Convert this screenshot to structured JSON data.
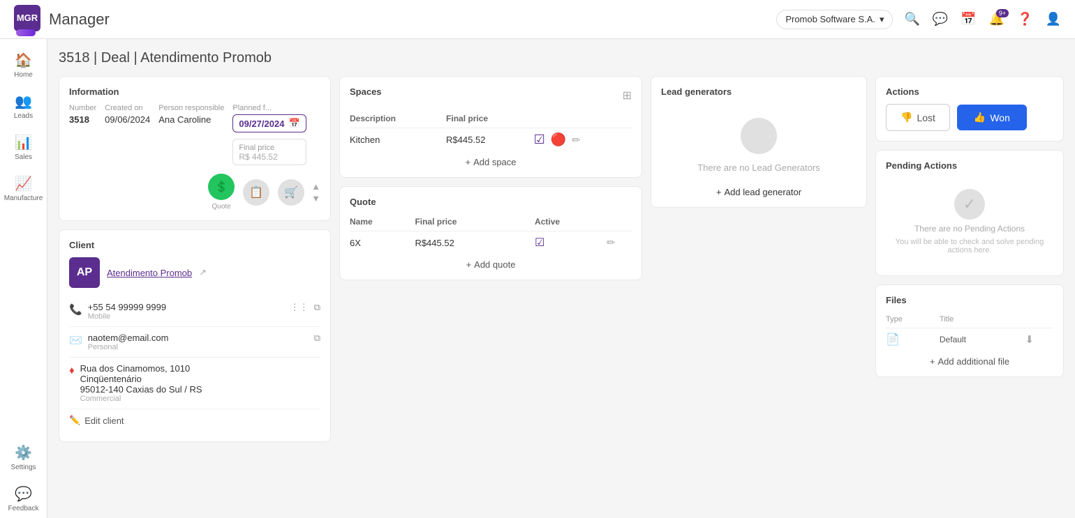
{
  "header": {
    "app_name": "Manager",
    "company": "Promob Software S.A.",
    "logo_abbr": "MGR"
  },
  "sidebar": {
    "items": [
      {
        "label": "Home",
        "icon": "🏠",
        "active": false
      },
      {
        "label": "Leads",
        "icon": "👥",
        "active": false
      },
      {
        "label": "Sales",
        "icon": "📊",
        "active": false
      },
      {
        "label": "Manufacture",
        "icon": "🏭",
        "active": false
      },
      {
        "label": "Settings",
        "icon": "⚙️",
        "active": false
      },
      {
        "label": "Feedback",
        "icon": "💬",
        "active": false
      }
    ]
  },
  "page": {
    "title": "3518 | Deal | Atendimento Promob"
  },
  "information": {
    "section_title": "Information",
    "number_label": "Number",
    "number_value": "3518",
    "created_on_label": "Created on",
    "created_on_value": "09/06/2024",
    "person_responsible_label": "Person responsible",
    "person_responsible_value": "Ana Caroline",
    "planned_date_label": "Planned f...",
    "planned_date_value": "09/27/2024",
    "final_price_label": "Final price",
    "final_price_value": "R$ 445.52"
  },
  "pipeline": {
    "steps": [
      {
        "label": "Quote",
        "icon": "$",
        "active": true
      },
      {
        "label": "",
        "icon": "📋",
        "active": false
      },
      {
        "label": "",
        "icon": "🛒",
        "active": false
      }
    ]
  },
  "lead_generators": {
    "section_title": "Lead generators",
    "empty_message": "There are no Lead Generators",
    "add_label": "Add lead generator"
  },
  "client": {
    "section_title": "Client",
    "avatar_initials": "AP",
    "name": "Atendimento Promob",
    "phone": "+55 54 99999 9999",
    "phone_type": "Mobile",
    "email": "naotem@email.com",
    "email_type": "Personal",
    "address_line1": "Rua dos Cinamomos, 1010",
    "address_line2": "Cinqüentenário",
    "address_line3": "95012-140 Caxias do Sul / RS",
    "address_type": "Commercial",
    "edit_label": "Edit client"
  },
  "spaces": {
    "section_title": "Spaces",
    "columns": [
      "Description",
      "Final price",
      ""
    ],
    "rows": [
      {
        "description": "Kitchen",
        "final_price": "R$445.52"
      }
    ],
    "add_label": "Add space"
  },
  "quote": {
    "section_title": "Quote",
    "columns": [
      "Name",
      "Final price",
      "Active"
    ],
    "rows": [
      {
        "name": "6X",
        "final_price": "R$445.52",
        "active": true
      }
    ],
    "add_label": "Add quote"
  },
  "actions": {
    "section_title": "Actions",
    "lost_label": "Lost",
    "won_label": "Won"
  },
  "pending_actions": {
    "section_title": "Pending Actions",
    "empty_title": "There are no Pending Actions",
    "empty_subtitle": "You will be able to check and solve pending actions here."
  },
  "files": {
    "section_title": "Files",
    "columns": [
      "Type",
      "Title"
    ],
    "rows": [
      {
        "type_icon": "📄",
        "title": "Default"
      }
    ],
    "add_label": "Add additional file"
  }
}
